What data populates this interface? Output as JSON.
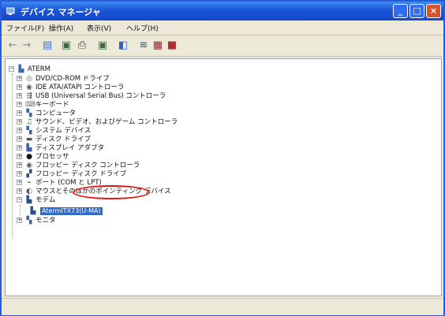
{
  "window": {
    "title": "デバイス マネージャ"
  },
  "menu": {
    "items": [
      "ファイル(F)",
      "操作(A)",
      "表示(V)",
      "ヘルプ(H)"
    ]
  },
  "toolbar": {
    "icons": [
      "back-icon",
      "forward-icon",
      "view-icon",
      "properties-icon",
      "print-icon",
      "help-icon",
      "scan-icon",
      "update-driver-icon",
      "disable-icon",
      "uninstall-icon"
    ]
  },
  "tree": {
    "root": "ATERM",
    "items": [
      {
        "label": "DVD/CD-ROM ドライブ",
        "icon": "cdrom-icon"
      },
      {
        "label": "IDE ATA/ATAPI コントローラ",
        "icon": "ide-icon"
      },
      {
        "label": "USB (Universal Serial Bus) コントローラ",
        "icon": "usb-icon"
      },
      {
        "label": "キーボード",
        "icon": "keyboard-icon"
      },
      {
        "label": "コンピュータ",
        "icon": "computer-icon"
      },
      {
        "label": "サウンド、ビデオ、およびゲーム コントローラ",
        "icon": "sound-icon"
      },
      {
        "label": "システム デバイス",
        "icon": "system-icon"
      },
      {
        "label": "ディスク ドライブ",
        "icon": "disk-icon"
      },
      {
        "label": "ディスプレイ アダプタ",
        "icon": "display-icon"
      },
      {
        "label": "プロセッサ",
        "icon": "processor-icon"
      },
      {
        "label": "フロッピー ディスク コントローラ",
        "icon": "floppy-controller-icon"
      },
      {
        "label": "フロッピー ディスク ドライブ",
        "icon": "floppy-drive-icon"
      },
      {
        "label": "ポート (COM と LPT)",
        "icon": "port-icon"
      },
      {
        "label": "マウスとそのほかのポインティング デバイス",
        "icon": "mouse-icon"
      },
      {
        "label": "モデム",
        "icon": "modem-icon"
      },
      {
        "label": "モニタ",
        "icon": "monitor-icon"
      }
    ],
    "modem_child": "AtermITX73(U-MA)"
  }
}
